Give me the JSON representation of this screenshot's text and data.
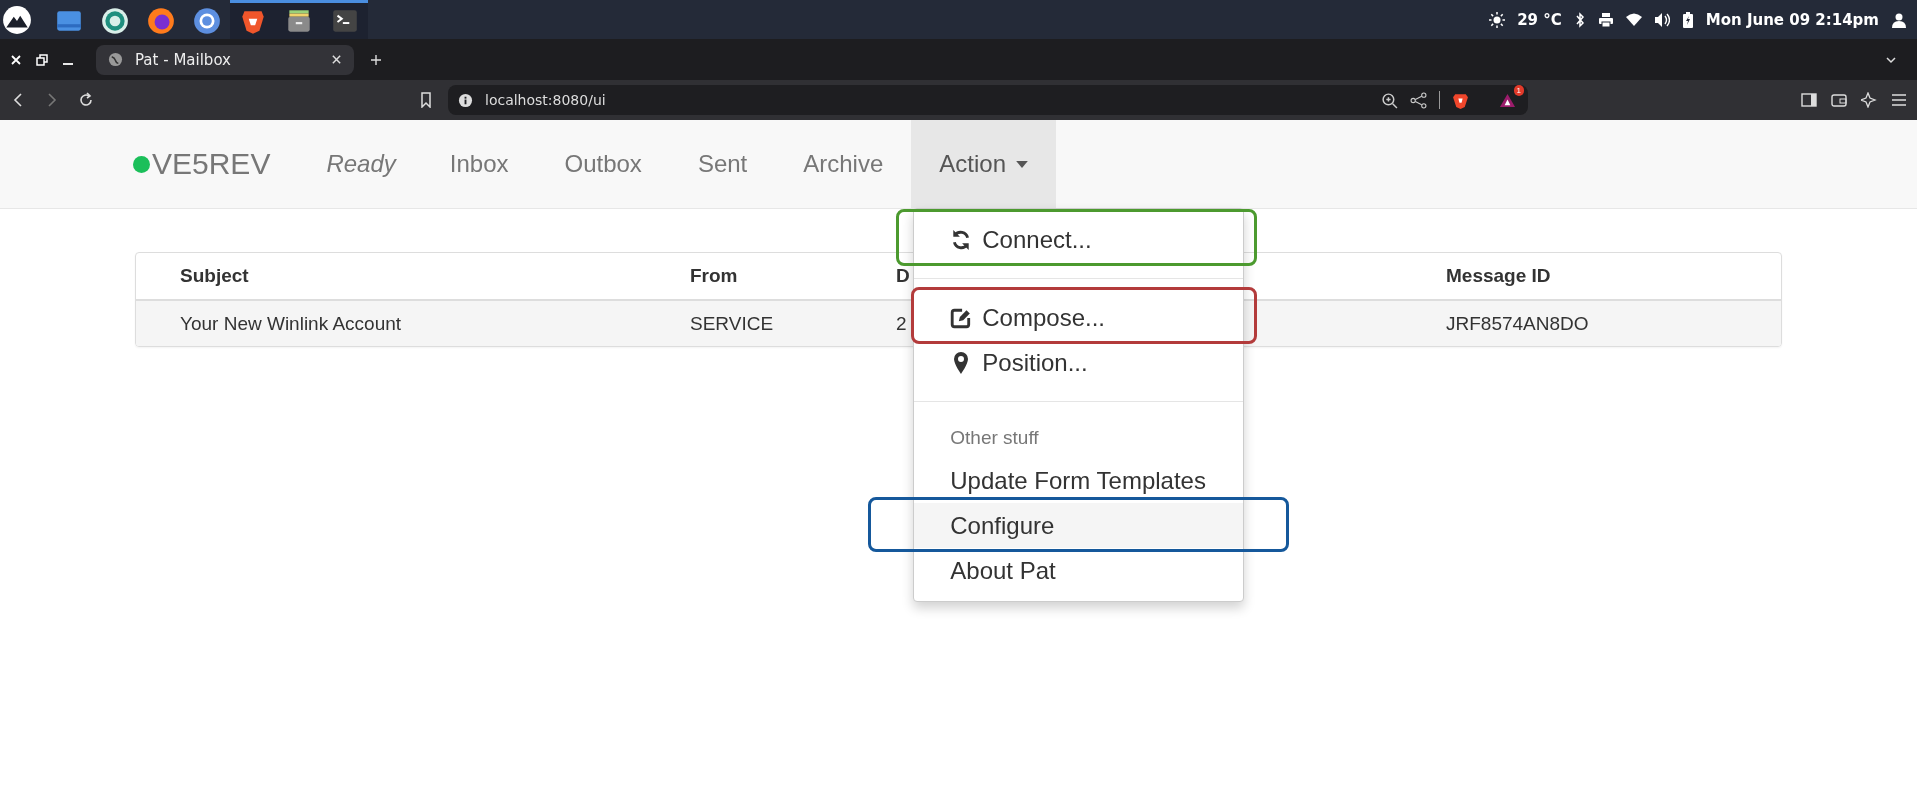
{
  "system_bar": {
    "apps": [
      {
        "running": false
      },
      {
        "running": false
      },
      {
        "running": false
      },
      {
        "running": false
      },
      {
        "running": true
      },
      {
        "running": true
      },
      {
        "running": true
      }
    ],
    "tray": {
      "temperature": "29 °C",
      "clock": "Mon June 09 2:14pm"
    }
  },
  "browser": {
    "tabs": [
      {
        "title": "Pat - Mailbox",
        "selected": true
      }
    ],
    "url": "localhost:8080/ui",
    "rewards_badge": "1"
  },
  "navbar": {
    "brand": "VE5REV",
    "online": true,
    "status": "Ready",
    "items": [
      {
        "label": "Inbox",
        "selected": false
      },
      {
        "label": "Outbox",
        "selected": false
      },
      {
        "label": "Sent",
        "selected": false
      },
      {
        "label": "Archive",
        "selected": false
      }
    ],
    "menu": {
      "label": "Action",
      "open": true
    }
  },
  "table": {
    "columns": [
      "Subject",
      "From",
      "D",
      "Message ID"
    ],
    "rows": [
      {
        "cells": [
          "Your New Winlink Account",
          "SERVICE",
          "2",
          "JRF8574AN8DO"
        ]
      }
    ]
  },
  "dropdown": {
    "items": [
      {
        "kind": "item",
        "label": "Connect...",
        "hovered": false,
        "color": "#4c9a2f"
      },
      {
        "kind": "divider"
      },
      {
        "kind": "item",
        "label": "Compose...",
        "hovered": false,
        "color": "#b33b3b"
      },
      {
        "kind": "item",
        "label": "Position...",
        "hovered": false
      },
      {
        "kind": "divider"
      },
      {
        "kind": "header",
        "label": "Other stuff"
      },
      {
        "kind": "item",
        "label": "Update Form Templates",
        "hovered": false
      },
      {
        "kind": "item",
        "label": "Configure",
        "hovered": true,
        "color": "#15589b"
      },
      {
        "kind": "item",
        "label": "About Pat",
        "hovered": false
      }
    ]
  }
}
